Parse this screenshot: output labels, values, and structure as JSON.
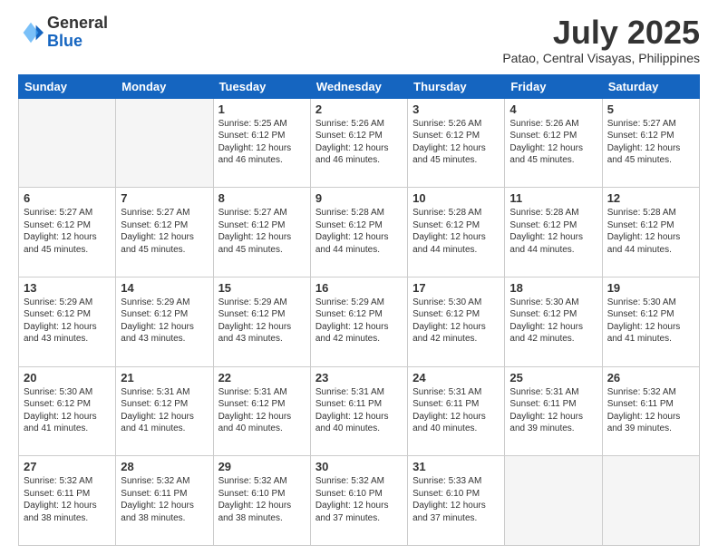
{
  "logo": {
    "general": "General",
    "blue": "Blue"
  },
  "header": {
    "title": "July 2025",
    "subtitle": "Patao, Central Visayas, Philippines"
  },
  "weekdays": [
    "Sunday",
    "Monday",
    "Tuesday",
    "Wednesday",
    "Thursday",
    "Friday",
    "Saturday"
  ],
  "weeks": [
    [
      {
        "day": "",
        "info": ""
      },
      {
        "day": "",
        "info": ""
      },
      {
        "day": "1",
        "info": "Sunrise: 5:25 AM\nSunset: 6:12 PM\nDaylight: 12 hours and 46 minutes."
      },
      {
        "day": "2",
        "info": "Sunrise: 5:26 AM\nSunset: 6:12 PM\nDaylight: 12 hours and 46 minutes."
      },
      {
        "day": "3",
        "info": "Sunrise: 5:26 AM\nSunset: 6:12 PM\nDaylight: 12 hours and 45 minutes."
      },
      {
        "day": "4",
        "info": "Sunrise: 5:26 AM\nSunset: 6:12 PM\nDaylight: 12 hours and 45 minutes."
      },
      {
        "day": "5",
        "info": "Sunrise: 5:27 AM\nSunset: 6:12 PM\nDaylight: 12 hours and 45 minutes."
      }
    ],
    [
      {
        "day": "6",
        "info": "Sunrise: 5:27 AM\nSunset: 6:12 PM\nDaylight: 12 hours and 45 minutes."
      },
      {
        "day": "7",
        "info": "Sunrise: 5:27 AM\nSunset: 6:12 PM\nDaylight: 12 hours and 45 minutes."
      },
      {
        "day": "8",
        "info": "Sunrise: 5:27 AM\nSunset: 6:12 PM\nDaylight: 12 hours and 45 minutes."
      },
      {
        "day": "9",
        "info": "Sunrise: 5:28 AM\nSunset: 6:12 PM\nDaylight: 12 hours and 44 minutes."
      },
      {
        "day": "10",
        "info": "Sunrise: 5:28 AM\nSunset: 6:12 PM\nDaylight: 12 hours and 44 minutes."
      },
      {
        "day": "11",
        "info": "Sunrise: 5:28 AM\nSunset: 6:12 PM\nDaylight: 12 hours and 44 minutes."
      },
      {
        "day": "12",
        "info": "Sunrise: 5:28 AM\nSunset: 6:12 PM\nDaylight: 12 hours and 44 minutes."
      }
    ],
    [
      {
        "day": "13",
        "info": "Sunrise: 5:29 AM\nSunset: 6:12 PM\nDaylight: 12 hours and 43 minutes."
      },
      {
        "day": "14",
        "info": "Sunrise: 5:29 AM\nSunset: 6:12 PM\nDaylight: 12 hours and 43 minutes."
      },
      {
        "day": "15",
        "info": "Sunrise: 5:29 AM\nSunset: 6:12 PM\nDaylight: 12 hours and 43 minutes."
      },
      {
        "day": "16",
        "info": "Sunrise: 5:29 AM\nSunset: 6:12 PM\nDaylight: 12 hours and 42 minutes."
      },
      {
        "day": "17",
        "info": "Sunrise: 5:30 AM\nSunset: 6:12 PM\nDaylight: 12 hours and 42 minutes."
      },
      {
        "day": "18",
        "info": "Sunrise: 5:30 AM\nSunset: 6:12 PM\nDaylight: 12 hours and 42 minutes."
      },
      {
        "day": "19",
        "info": "Sunrise: 5:30 AM\nSunset: 6:12 PM\nDaylight: 12 hours and 41 minutes."
      }
    ],
    [
      {
        "day": "20",
        "info": "Sunrise: 5:30 AM\nSunset: 6:12 PM\nDaylight: 12 hours and 41 minutes."
      },
      {
        "day": "21",
        "info": "Sunrise: 5:31 AM\nSunset: 6:12 PM\nDaylight: 12 hours and 41 minutes."
      },
      {
        "day": "22",
        "info": "Sunrise: 5:31 AM\nSunset: 6:12 PM\nDaylight: 12 hours and 40 minutes."
      },
      {
        "day": "23",
        "info": "Sunrise: 5:31 AM\nSunset: 6:11 PM\nDaylight: 12 hours and 40 minutes."
      },
      {
        "day": "24",
        "info": "Sunrise: 5:31 AM\nSunset: 6:11 PM\nDaylight: 12 hours and 40 minutes."
      },
      {
        "day": "25",
        "info": "Sunrise: 5:31 AM\nSunset: 6:11 PM\nDaylight: 12 hours and 39 minutes."
      },
      {
        "day": "26",
        "info": "Sunrise: 5:32 AM\nSunset: 6:11 PM\nDaylight: 12 hours and 39 minutes."
      }
    ],
    [
      {
        "day": "27",
        "info": "Sunrise: 5:32 AM\nSunset: 6:11 PM\nDaylight: 12 hours and 38 minutes."
      },
      {
        "day": "28",
        "info": "Sunrise: 5:32 AM\nSunset: 6:11 PM\nDaylight: 12 hours and 38 minutes."
      },
      {
        "day": "29",
        "info": "Sunrise: 5:32 AM\nSunset: 6:10 PM\nDaylight: 12 hours and 38 minutes."
      },
      {
        "day": "30",
        "info": "Sunrise: 5:32 AM\nSunset: 6:10 PM\nDaylight: 12 hours and 37 minutes."
      },
      {
        "day": "31",
        "info": "Sunrise: 5:33 AM\nSunset: 6:10 PM\nDaylight: 12 hours and 37 minutes."
      },
      {
        "day": "",
        "info": ""
      },
      {
        "day": "",
        "info": ""
      }
    ]
  ]
}
